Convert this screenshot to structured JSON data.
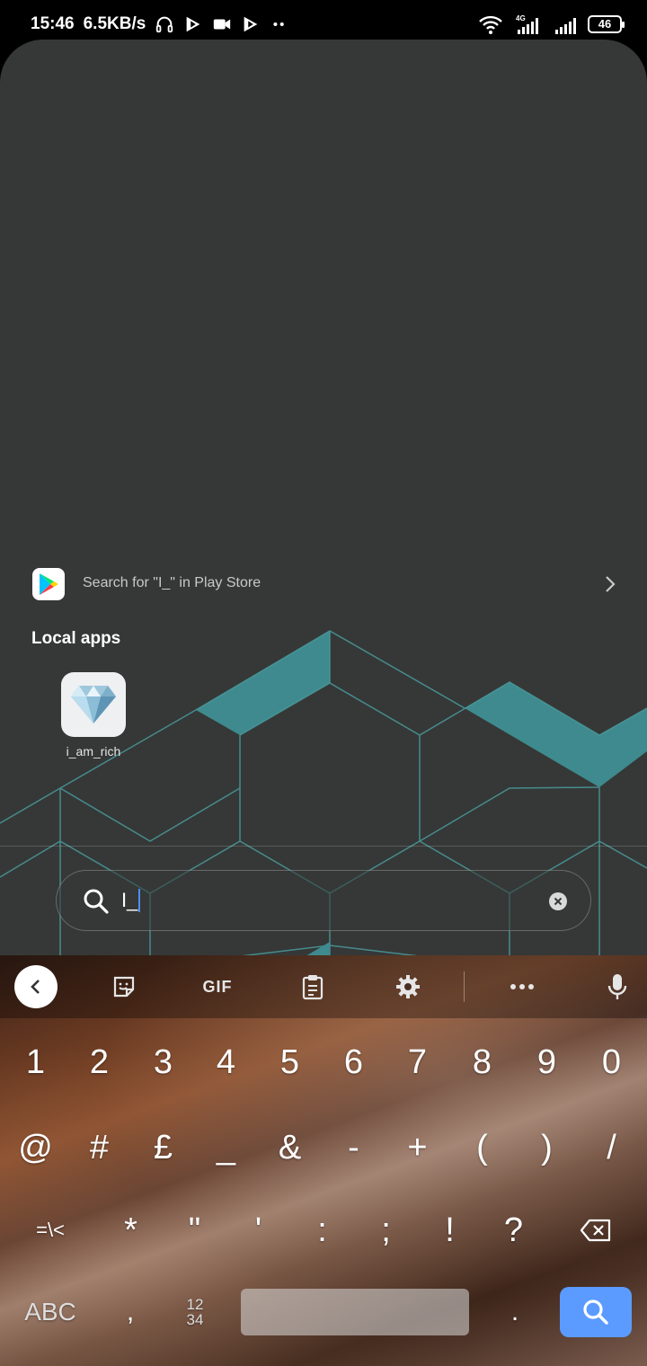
{
  "status_bar": {
    "time": "15:46",
    "speed": "6.5KB/s",
    "battery": "46",
    "network": "4G"
  },
  "play_store": {
    "text": "Search for \"I_\" in Play Store"
  },
  "local_apps": {
    "title": "Local apps",
    "apps": [
      {
        "label": "i_am_rich",
        "icon": "diamond-icon"
      }
    ]
  },
  "search": {
    "value": "I_"
  },
  "keyboard": {
    "toolbar": {
      "gif_label": "GIF"
    },
    "row1": [
      "1",
      "2",
      "3",
      "4",
      "5",
      "6",
      "7",
      "8",
      "9",
      "0"
    ],
    "row2": [
      "@",
      "#",
      "£",
      "_",
      "&",
      "-",
      "+",
      "(",
      ")",
      "/"
    ],
    "row3": [
      "=\\<",
      "*",
      "\"",
      "'",
      ":",
      ";",
      "!",
      "?"
    ],
    "bottom": {
      "abc": "ABC",
      "comma": ",",
      "num_top": "12",
      "num_bottom": "34",
      "period": "."
    }
  },
  "colors": {
    "panel_bg": "#353837",
    "accent_teal": "#3e8a8e",
    "enter_key": "#5b9bff"
  }
}
